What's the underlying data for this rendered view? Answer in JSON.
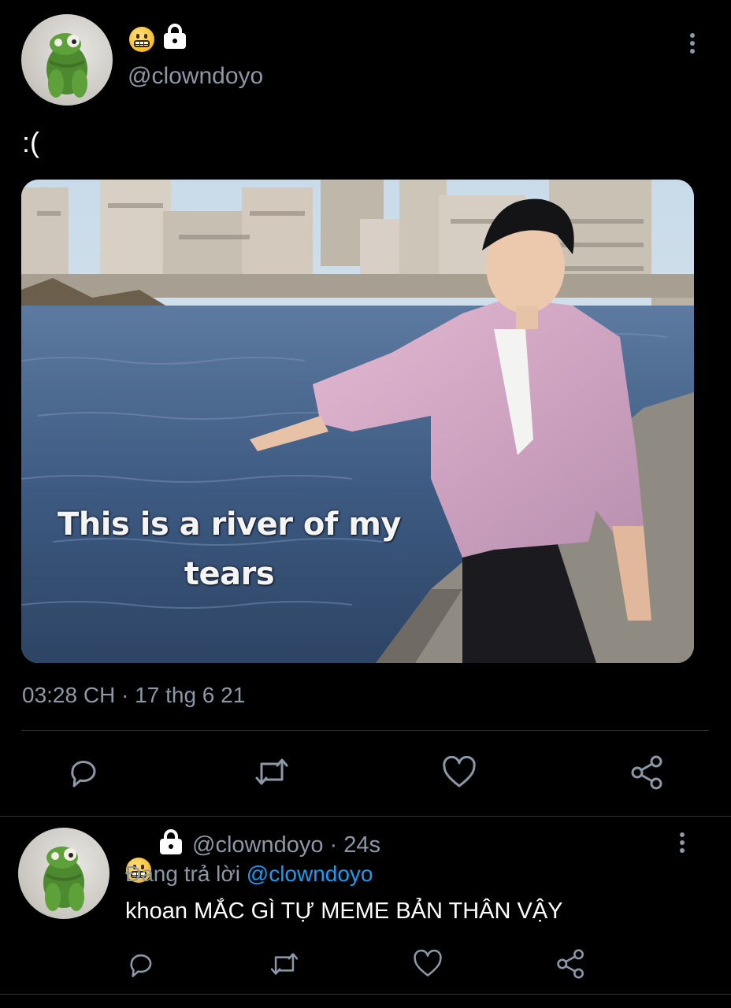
{
  "main_tweet": {
    "avatar_icon": "green-frog-plush-avatar",
    "status_emoji": "grimacing-face-emoji",
    "protected_icon": "lock-icon",
    "handle": "@clowndoyo",
    "text": ":(",
    "media": {
      "caption_line1": "This is a river of my",
      "caption_line2": "tears"
    },
    "timestamp": "03:28 CH · 17 thg 6 21",
    "actions": [
      "reply-icon",
      "retweet-icon",
      "like-icon",
      "share-icon"
    ]
  },
  "reply_tweet": {
    "avatar_icon": "green-frog-plush-avatar",
    "handle_time": "@clowndoyo · 24s",
    "replying_label": "Đang trả lời",
    "replying_to": "@clowndoyo",
    "text": "khoan MẮC GÌ TỰ MEME BẢN THÂN VẬY",
    "actions": [
      "reply-icon",
      "retweet-icon",
      "like-icon",
      "share-icon"
    ]
  },
  "colors": {
    "background": "#000000",
    "secondary_text": "#8b98a5",
    "link": "#1d9bf0",
    "divider": "#2f3336"
  }
}
